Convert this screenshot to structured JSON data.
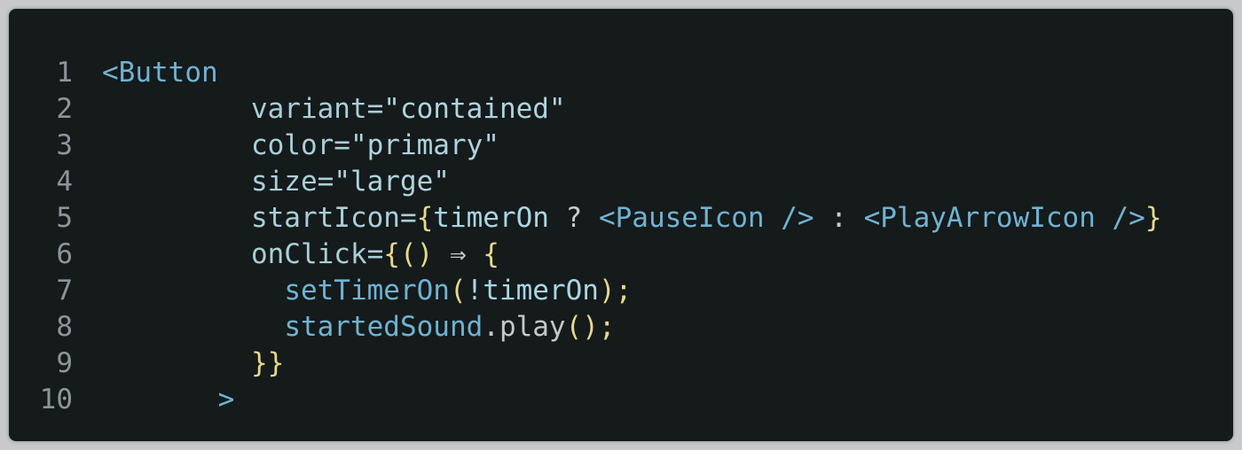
{
  "editor": {
    "lines": [
      {
        "n": "1",
        "indent": "",
        "tokens": [
          {
            "t": "<Button",
            "c": "tag"
          }
        ]
      },
      {
        "n": "2",
        "indent": "         ",
        "tokens": [
          {
            "t": "variant=",
            "c": "attr"
          },
          {
            "t": "\"contained\"",
            "c": "str"
          }
        ]
      },
      {
        "n": "3",
        "indent": "         ",
        "tokens": [
          {
            "t": "color=",
            "c": "attr"
          },
          {
            "t": "\"primary\"",
            "c": "str"
          }
        ]
      },
      {
        "n": "4",
        "indent": "         ",
        "tokens": [
          {
            "t": "size=",
            "c": "attr"
          },
          {
            "t": "\"large\"",
            "c": "str"
          }
        ]
      },
      {
        "n": "5",
        "indent": "         ",
        "tokens": [
          {
            "t": "startIcon=",
            "c": "attr"
          },
          {
            "t": "{",
            "c": "punc"
          },
          {
            "t": "timerOn",
            "c": "ident"
          },
          {
            "t": " ? ",
            "c": "op"
          },
          {
            "t": "<PauseIcon />",
            "c": "tag"
          },
          {
            "t": " : ",
            "c": "op"
          },
          {
            "t": "<PlayArrowIcon />",
            "c": "tag"
          },
          {
            "t": "}",
            "c": "punc"
          }
        ]
      },
      {
        "n": "6",
        "indent": "         ",
        "tokens": [
          {
            "t": "onClick=",
            "c": "attr"
          },
          {
            "t": "{",
            "c": "punc"
          },
          {
            "t": "()",
            "c": "punc"
          },
          {
            "t": " ⇒ ",
            "c": "op"
          },
          {
            "t": "{",
            "c": "punc"
          }
        ]
      },
      {
        "n": "7",
        "indent": "           ",
        "tokens": [
          {
            "t": "setTimerOn",
            "c": "fn"
          },
          {
            "t": "(",
            "c": "punc"
          },
          {
            "t": "!timerOn",
            "c": "ident"
          },
          {
            "t": ");",
            "c": "punc"
          }
        ]
      },
      {
        "n": "8",
        "indent": "           ",
        "tokens": [
          {
            "t": "startedSound",
            "c": "fn"
          },
          {
            "t": ".play",
            "c": "dim"
          },
          {
            "t": "();",
            "c": "punc"
          }
        ]
      },
      {
        "n": "9",
        "indent": "         ",
        "tokens": [
          {
            "t": "}}",
            "c": "punc"
          }
        ]
      },
      {
        "n": "10",
        "indent": "       ",
        "tokens": [
          {
            "t": ">",
            "c": "tag"
          }
        ]
      }
    ]
  }
}
